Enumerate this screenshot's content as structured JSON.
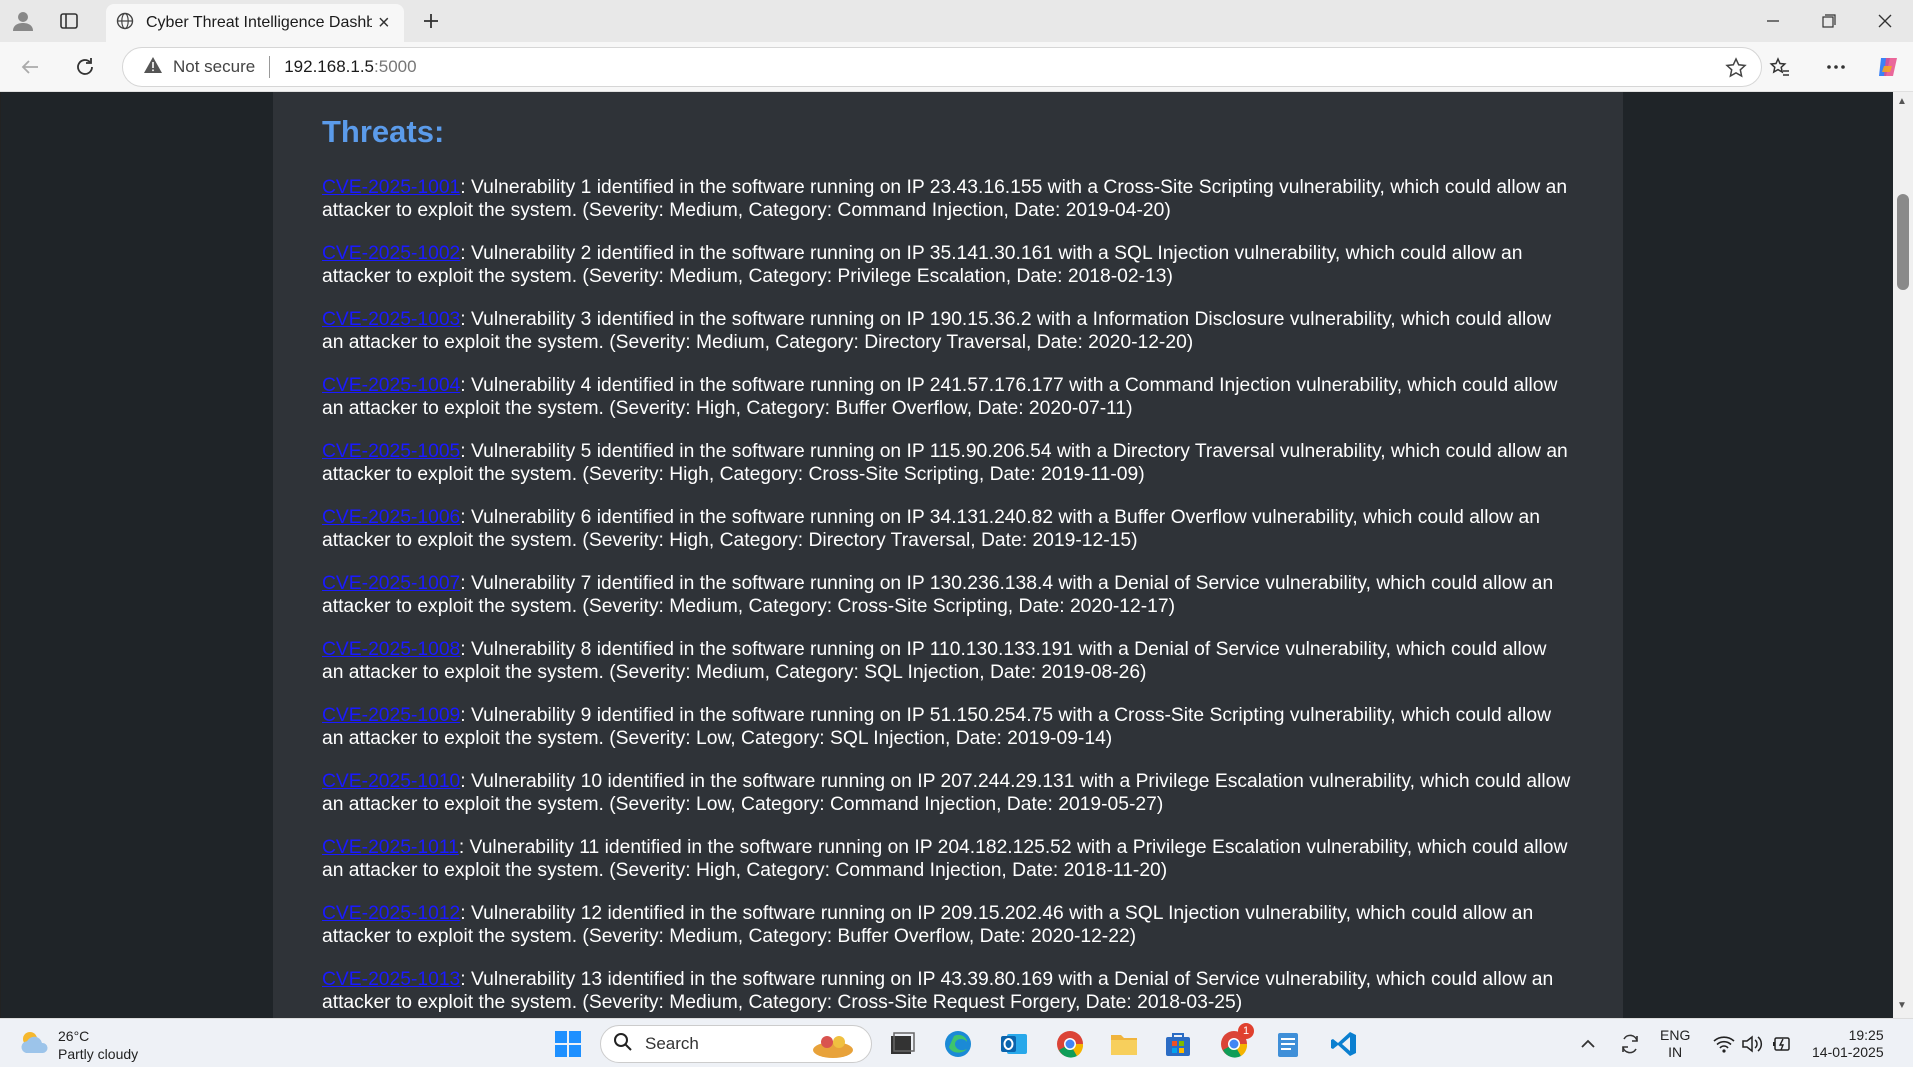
{
  "browser": {
    "tab_title": "Cyber Threat Intelligence Dashbo",
    "security_label": "Not secure",
    "url_host": "192.168.1.5",
    "url_port": ":5000"
  },
  "page": {
    "heading": "Threats:",
    "threats": [
      {
        "id": "CVE-2025-1001",
        "text": ": Vulnerability 1 identified in the software running on IP 23.43.16.155 with a Cross-Site Scripting vulnerability, which could allow an attacker to exploit the system. (Severity: Medium, Category: Command Injection, Date: 2019-04-20)"
      },
      {
        "id": "CVE-2025-1002",
        "text": ": Vulnerability 2 identified in the software running on IP 35.141.30.161 with a SQL Injection vulnerability, which could allow an attacker to exploit the system. (Severity: Medium, Category: Privilege Escalation, Date: 2018-02-13)"
      },
      {
        "id": "CVE-2025-1003",
        "text": ": Vulnerability 3 identified in the software running on IP 190.15.36.2 with a Information Disclosure vulnerability, which could allow an attacker to exploit the system. (Severity: Medium, Category: Directory Traversal, Date: 2020-12-20)"
      },
      {
        "id": "CVE-2025-1004",
        "text": ": Vulnerability 4 identified in the software running on IP 241.57.176.177 with a Command Injection vulnerability, which could allow an attacker to exploit the system. (Severity: High, Category: Buffer Overflow, Date: 2020-07-11)"
      },
      {
        "id": "CVE-2025-1005",
        "text": ": Vulnerability 5 identified in the software running on IP 115.90.206.54 with a Directory Traversal vulnerability, which could allow an attacker to exploit the system. (Severity: High, Category: Cross-Site Scripting, Date: 2019-11-09)"
      },
      {
        "id": "CVE-2025-1006",
        "text": ": Vulnerability 6 identified in the software running on IP 34.131.240.82 with a Buffer Overflow vulnerability, which could allow an attacker to exploit the system. (Severity: High, Category: Directory Traversal, Date: 2019-12-15)"
      },
      {
        "id": "CVE-2025-1007",
        "text": ": Vulnerability 7 identified in the software running on IP 130.236.138.4 with a Denial of Service vulnerability, which could allow an attacker to exploit the system. (Severity: Medium, Category: Cross-Site Scripting, Date: 2020-12-17)"
      },
      {
        "id": "CVE-2025-1008",
        "text": ": Vulnerability 8 identified in the software running on IP 110.130.133.191 with a Denial of Service vulnerability, which could allow an attacker to exploit the system. (Severity: Medium, Category: SQL Injection, Date: 2019-08-26)"
      },
      {
        "id": "CVE-2025-1009",
        "text": ": Vulnerability 9 identified in the software running on IP 51.150.254.75 with a Cross-Site Scripting vulnerability, which could allow an attacker to exploit the system. (Severity: Low, Category: SQL Injection, Date: 2019-09-14)"
      },
      {
        "id": "CVE-2025-1010",
        "text": ": Vulnerability 10 identified in the software running on IP 207.244.29.131 with a Privilege Escalation vulnerability, which could allow an attacker to exploit the system. (Severity: Low, Category: Command Injection, Date: 2019-05-27)"
      },
      {
        "id": "CVE-2025-1011",
        "text": ": Vulnerability 11 identified in the software running on IP 204.182.125.52 with a Privilege Escalation vulnerability, which could allow an attacker to exploit the system. (Severity: High, Category: Command Injection, Date: 2018-11-20)"
      },
      {
        "id": "CVE-2025-1012",
        "text": ": Vulnerability 12 identified in the software running on IP 209.15.202.46 with a SQL Injection vulnerability, which could allow an attacker to exploit the system. (Severity: Medium, Category: Buffer Overflow, Date: 2020-12-22)"
      },
      {
        "id": "CVE-2025-1013",
        "text": ": Vulnerability 13 identified in the software running on IP 43.39.80.169 with a Denial of Service vulnerability, which could allow an attacker to exploit the system. (Severity: Medium, Category: Cross-Site Request Forgery, Date: 2018-03-25)"
      }
    ]
  },
  "taskbar": {
    "temperature": "26°C",
    "weather": "Partly cloudy",
    "search_placeholder": "Search",
    "lang_top": "ENG",
    "lang_bottom": "IN",
    "time": "19:25",
    "date": "14-01-2025",
    "notification_count": "1"
  },
  "colors": {
    "heading": "#5b9bea",
    "link": "#1a1aff",
    "content_bg": "#2f3338",
    "page_bg": "#1f2428"
  }
}
